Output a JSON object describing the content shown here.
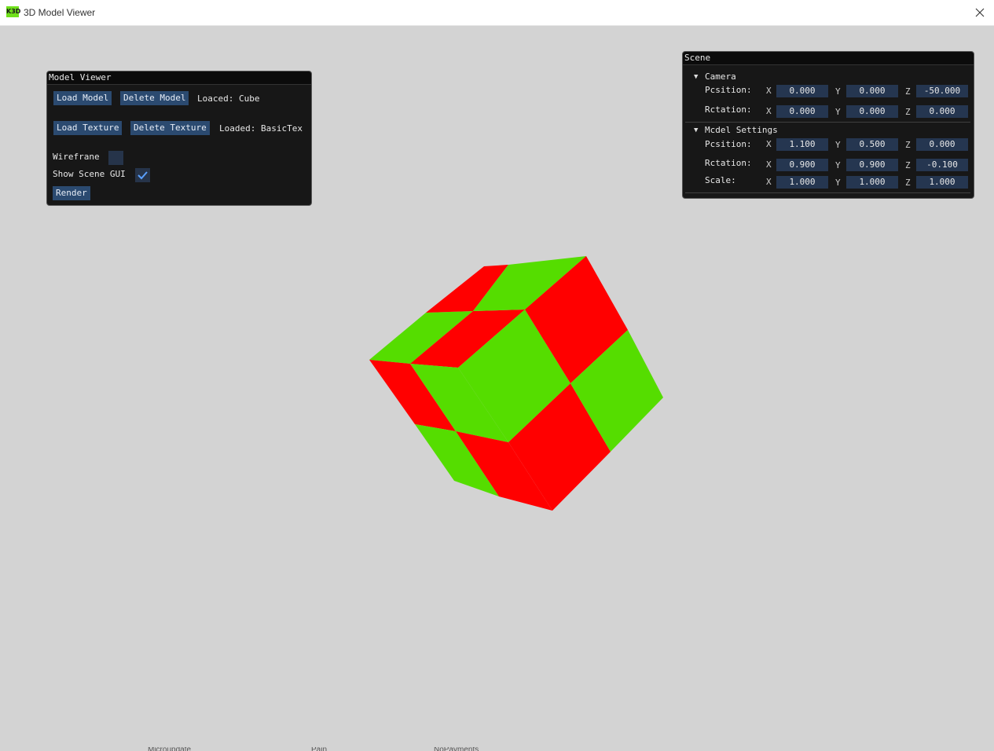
{
  "window": {
    "title": "3D Model Viewer",
    "icon_text": "K3D",
    "close_icon": "close-icon"
  },
  "viewport": {
    "background": "#d3d3d3",
    "cube_colors": {
      "red": "#ff0000",
      "green": "#55dd00"
    }
  },
  "model_viewer": {
    "title": "Model Viewer",
    "load_model_label": "Load Model",
    "delete_model_label": "Delete Model",
    "loaded_model_text": "Loaced: Cube",
    "load_texture_label": "Load Texture",
    "delete_texture_label": "Delete Texture",
    "loaded_texture_text": "Loaded: BasicTex",
    "wireframe_label": "Wirefrane",
    "wireframe_checked": false,
    "show_scene_gui_label": "Show Scene GUI",
    "show_scene_gui_checked": true,
    "render_label": "Render"
  },
  "scene": {
    "title": "Scene",
    "camera": {
      "header": "Camera",
      "position_label": "Pcsition:",
      "position": {
        "x": "0.000",
        "y": "0.000",
        "z": "-50.000"
      },
      "rotation_label": "Rctation:",
      "rotation": {
        "x": "0.000",
        "y": "0.000",
        "z": "0.000"
      }
    },
    "model_settings": {
      "header": "Mcdel Settings",
      "position_label": "Pcsition:",
      "position": {
        "x": "1.100",
        "y": "0.500",
        "z": "0.000"
      },
      "rotation_label": "Rctation:",
      "rotation": {
        "x": "0.900",
        "y": "0.900",
        "z": "-0.100"
      },
      "scale_label": "Scale:",
      "scale": {
        "x": "1.000",
        "y": "1.000",
        "z": "1.000"
      }
    },
    "axis_labels": {
      "x": "X",
      "y": "Y",
      "z": "Z"
    }
  },
  "background_taskbar_fragments": [
    "Microupdate",
    "Pain",
    "NoPayments"
  ]
}
